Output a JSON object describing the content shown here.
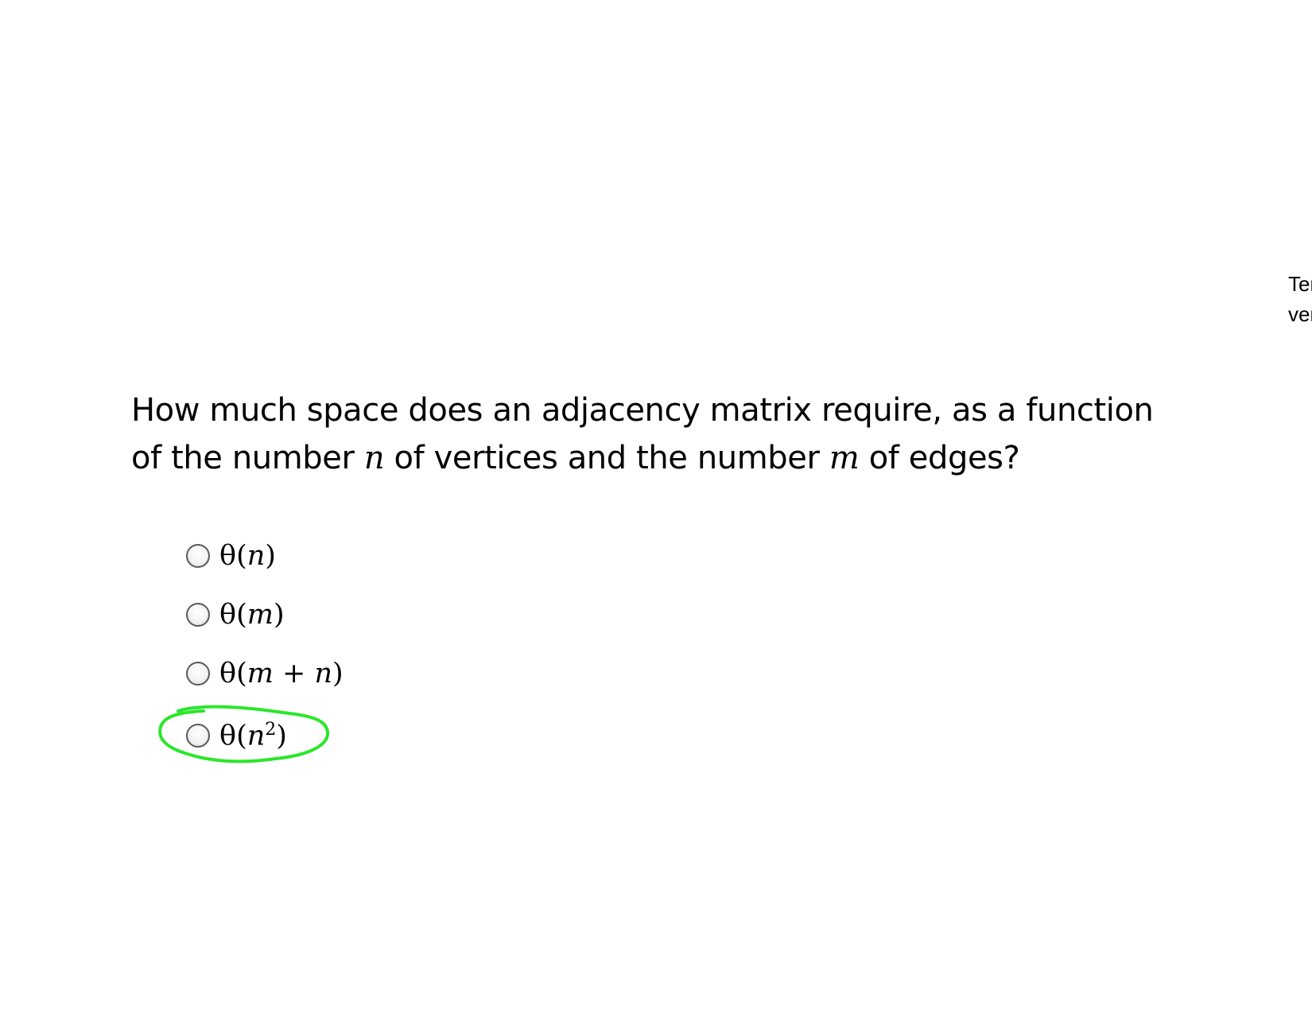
{
  "side_note": {
    "line1": "Ter",
    "line2": "ver"
  },
  "question": {
    "part1": "How much space does an adjacency matrix require, as a function",
    "part2a": "of the number ",
    "var_n": "n",
    "part2b": " of vertices and the number ",
    "var_m": "m",
    "part2c": " of edges?"
  },
  "options": [
    {
      "func": "θ(",
      "arg": "n",
      "close": ")",
      "selected": false
    },
    {
      "func": "θ(",
      "arg": "m",
      "close": ")",
      "selected": false
    },
    {
      "func": "θ(",
      "arg": "m + n",
      "close": ")",
      "selected": false
    },
    {
      "func": "θ(",
      "arg": "n",
      "sup": "2",
      "close": ")",
      "selected": false,
      "highlighted": true
    }
  ],
  "colors": {
    "highlight": "#2be62b",
    "text": "#000000",
    "radio_border": "#5a5a5a"
  }
}
